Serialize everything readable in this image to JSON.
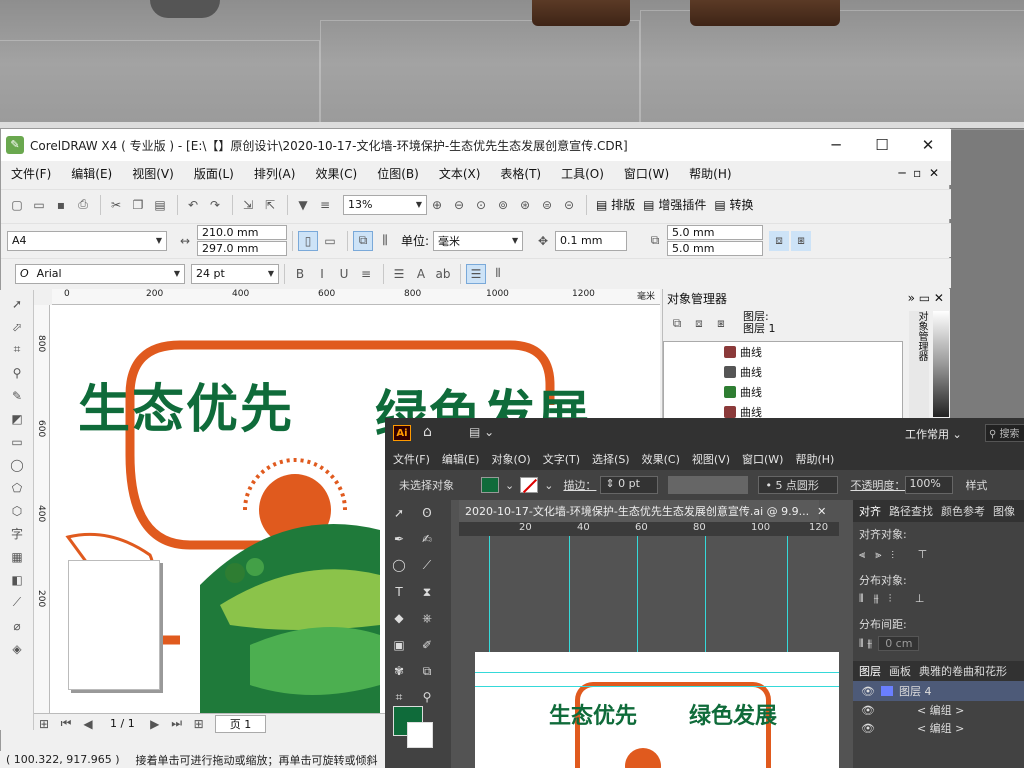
{
  "corel": {
    "title": "CorelDRAW X4 ( 专业版 ) - [E:\\【】原创设计\\2020-10-17-文化墙-环境保护-生态优先生态发展创意宣传.CDR]",
    "menu": [
      "文件(F)",
      "编辑(E)",
      "视图(V)",
      "版面(L)",
      "排列(A)",
      "效果(C)",
      "位图(B)",
      "文本(X)",
      "表格(T)",
      "工具(O)",
      "窗口(W)",
      "帮助(H)"
    ],
    "zoom": "13%",
    "plugins": {
      "layout": "排版",
      "enhance": "增强插件",
      "convert": "转换"
    },
    "paper": "A4",
    "width": "210.0 mm",
    "height": "297.0 mm",
    "units_label": "单位:",
    "units": "毫米",
    "nudge": "0.1 mm",
    "dup_x": "5.0 mm",
    "dup_y": "5.0 mm",
    "font": "Arial",
    "font_size": "24 pt",
    "ruler_h": [
      "0",
      "200",
      "400",
      "600",
      "800",
      "1000",
      "1200",
      "毫米"
    ],
    "ruler_v": [
      "800",
      "600",
      "400",
      "200"
    ],
    "page_nav": "1 / 1",
    "page_tab": "页 1",
    "status_coords": "( 100.322, 917.965 )",
    "status_hint": "接着单击可进行拖动或缩放；再单击可旋转或倾斜"
  },
  "objmgr": {
    "title": "对象管理器",
    "layer_label": "图层:",
    "layer_name": "图层 1",
    "items": [
      "曲线",
      "曲线",
      "曲线",
      "曲线"
    ],
    "side_tab": "对象管理器"
  },
  "artwork": {
    "title_left": "生态优先",
    "title_right": "绿色发展"
  },
  "ai": {
    "logo": "Ai",
    "workspace": "工作常用",
    "search": "搜索",
    "menu": [
      "文件(F)",
      "编辑(E)",
      "对象(O)",
      "文字(T)",
      "选择(S)",
      "效果(C)",
      "视图(V)",
      "窗口(W)",
      "帮助(H)"
    ],
    "selection": "未选择对象",
    "stroke_label": "描边：",
    "stroke_value": "0 pt",
    "brush": "5 点圆形",
    "opacity_label": "不透明度：",
    "opacity": "100%",
    "style_label": "样式",
    "doc_tab": "2020-10-17-文化墙-环境保护-生态优先生态发展创意宣传.ai @ 9.9...",
    "ruler": [
      "20",
      "40",
      "60",
      "80",
      "100",
      "120"
    ],
    "panel_tabs": [
      "对齐",
      "路径查找",
      "颜色参考",
      "图像"
    ],
    "align_objects": "对齐对象:",
    "distribute_objects": "分布对象:",
    "distribute_spacing": "分布间距:",
    "spacing_value": "0 cm",
    "layer_tabs": [
      "图层",
      "画板",
      "典雅的卷曲和花形"
    ],
    "layers": [
      "图层 4",
      "< 编组 >",
      "< 编组 >"
    ]
  },
  "colors": {
    "green": "#0f6b3a",
    "orange": "#e05a1e",
    "cyan_guide": "#35d9d9"
  }
}
